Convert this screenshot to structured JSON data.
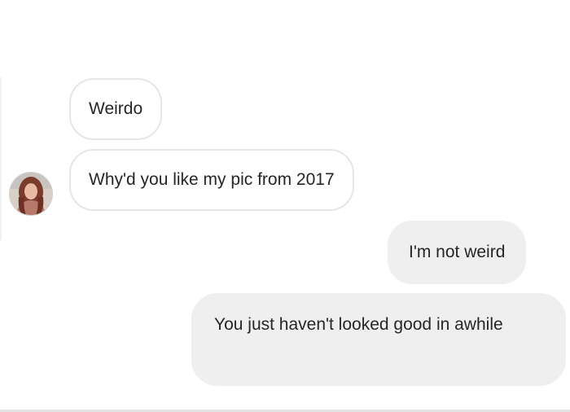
{
  "messages": [
    {
      "sender": "them",
      "text": "Weirdo"
    },
    {
      "sender": "them",
      "text": "Why'd you like my pic from 2017"
    },
    {
      "sender": "me",
      "text": "I'm not weird"
    },
    {
      "sender": "me",
      "text": "You just haven't looked good in awhile"
    }
  ],
  "avatar": {
    "icon": "profile-photo"
  },
  "colors": {
    "incoming_bubble": "#ffffff",
    "incoming_border": "#e6e6e6",
    "outgoing_bubble": "#efefef",
    "text": "#262626"
  }
}
